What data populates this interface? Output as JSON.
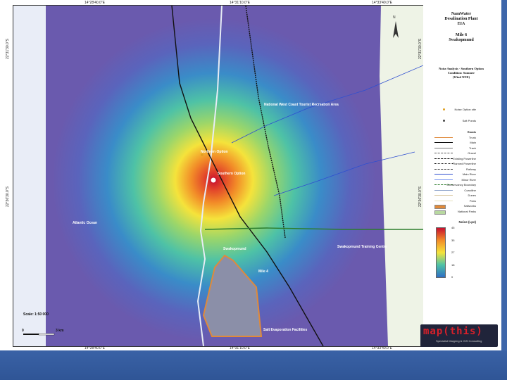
{
  "map": {
    "top_coords": [
      "14°28'40.0\"E",
      "14°31'10.0\"E",
      "14°33'40.0\"E"
    ],
    "bottom_coords": [
      "14°28'40.0\"E",
      "14°31'10.0\"E",
      "14°33'40.0\"E"
    ],
    "left_coords": [
      "22°31'30.0\"S",
      "22°36'30.0\"S"
    ],
    "right_coords": [
      "22°31'30.0\"S",
      "22°36'30.0\"S"
    ],
    "labels": {
      "recreation_area": "National West Coast Tourist Recreation Area",
      "northern_option": "Northern Option",
      "southern_option": "Southern Option",
      "ocean": "Atlantic Ocean",
      "town1": "Swakopmund",
      "town2": "Swakopmund Training Centre",
      "road": "Mile 4",
      "salt": "Salt Evaporation Facilities"
    },
    "scale": "Scale: 1:50 000",
    "scalebar_ticks": [
      "0",
      "3 km"
    ]
  },
  "legend": {
    "title_lines": [
      "NamWater",
      "Desalination Plant",
      "EIA",
      "",
      "Mile 6",
      "Swakopmund"
    ],
    "subtitle_lines": [
      "Noise Analysis - Southern Option",
      "Condition: Summer",
      "(Wind NNE)"
    ],
    "items": [
      {
        "label": "Noise Option site",
        "kind": "dot",
        "color": "#e0a020"
      },
      {
        "label": "Salt Ponds",
        "kind": "dot",
        "color": "#444"
      },
      {
        "label": "Roads",
        "kind": "header",
        "color": "#111"
      },
      {
        "label": "Trunk",
        "kind": "line",
        "color": "#e08a3a"
      },
      {
        "label": "Main",
        "kind": "line",
        "color": "#111"
      },
      {
        "label": "Track",
        "kind": "line",
        "color": "#777"
      },
      {
        "label": "Gravel",
        "kind": "dash",
        "color": "#555"
      },
      {
        "label": "Existing Powerline",
        "kind": "dash",
        "color": "#111"
      },
      {
        "label": "Planned Powerline",
        "kind": "dot-line",
        "color": "#111"
      },
      {
        "label": "Railway",
        "kind": "dash",
        "color": "#333"
      },
      {
        "label": "Main River",
        "kind": "line",
        "color": "#2f4fd0"
      },
      {
        "label": "Minor River",
        "kind": "line",
        "color": "#6f8ff0"
      },
      {
        "label": "Conservancy Boundary",
        "kind": "dash",
        "color": "#2c7d2c"
      },
      {
        "label": "Coastline",
        "kind": "line",
        "color": "#8aa0c8"
      },
      {
        "label": "Dunes",
        "kind": "line",
        "color": "#d9c8a0"
      },
      {
        "label": "Pans",
        "kind": "line",
        "color": "#e8e2c0"
      },
      {
        "label": "Saltworks",
        "kind": "box",
        "color": "#e08a3a"
      },
      {
        "label": "National Parks",
        "kind": "box",
        "color": "#b8d8a0"
      }
    ],
    "noise_title": "Noise (Lpe)",
    "noise_ticks": [
      "45",
      "35",
      "27",
      "18",
      "0"
    ],
    "noise_colors": [
      "#c8102e",
      "#f28c28",
      "#f5e33b",
      "#4ec2a6",
      "#2f6ec4"
    ]
  },
  "logo": {
    "text": "map(this)",
    "tagline": "Specialist Mapping & GIS Consulting"
  }
}
